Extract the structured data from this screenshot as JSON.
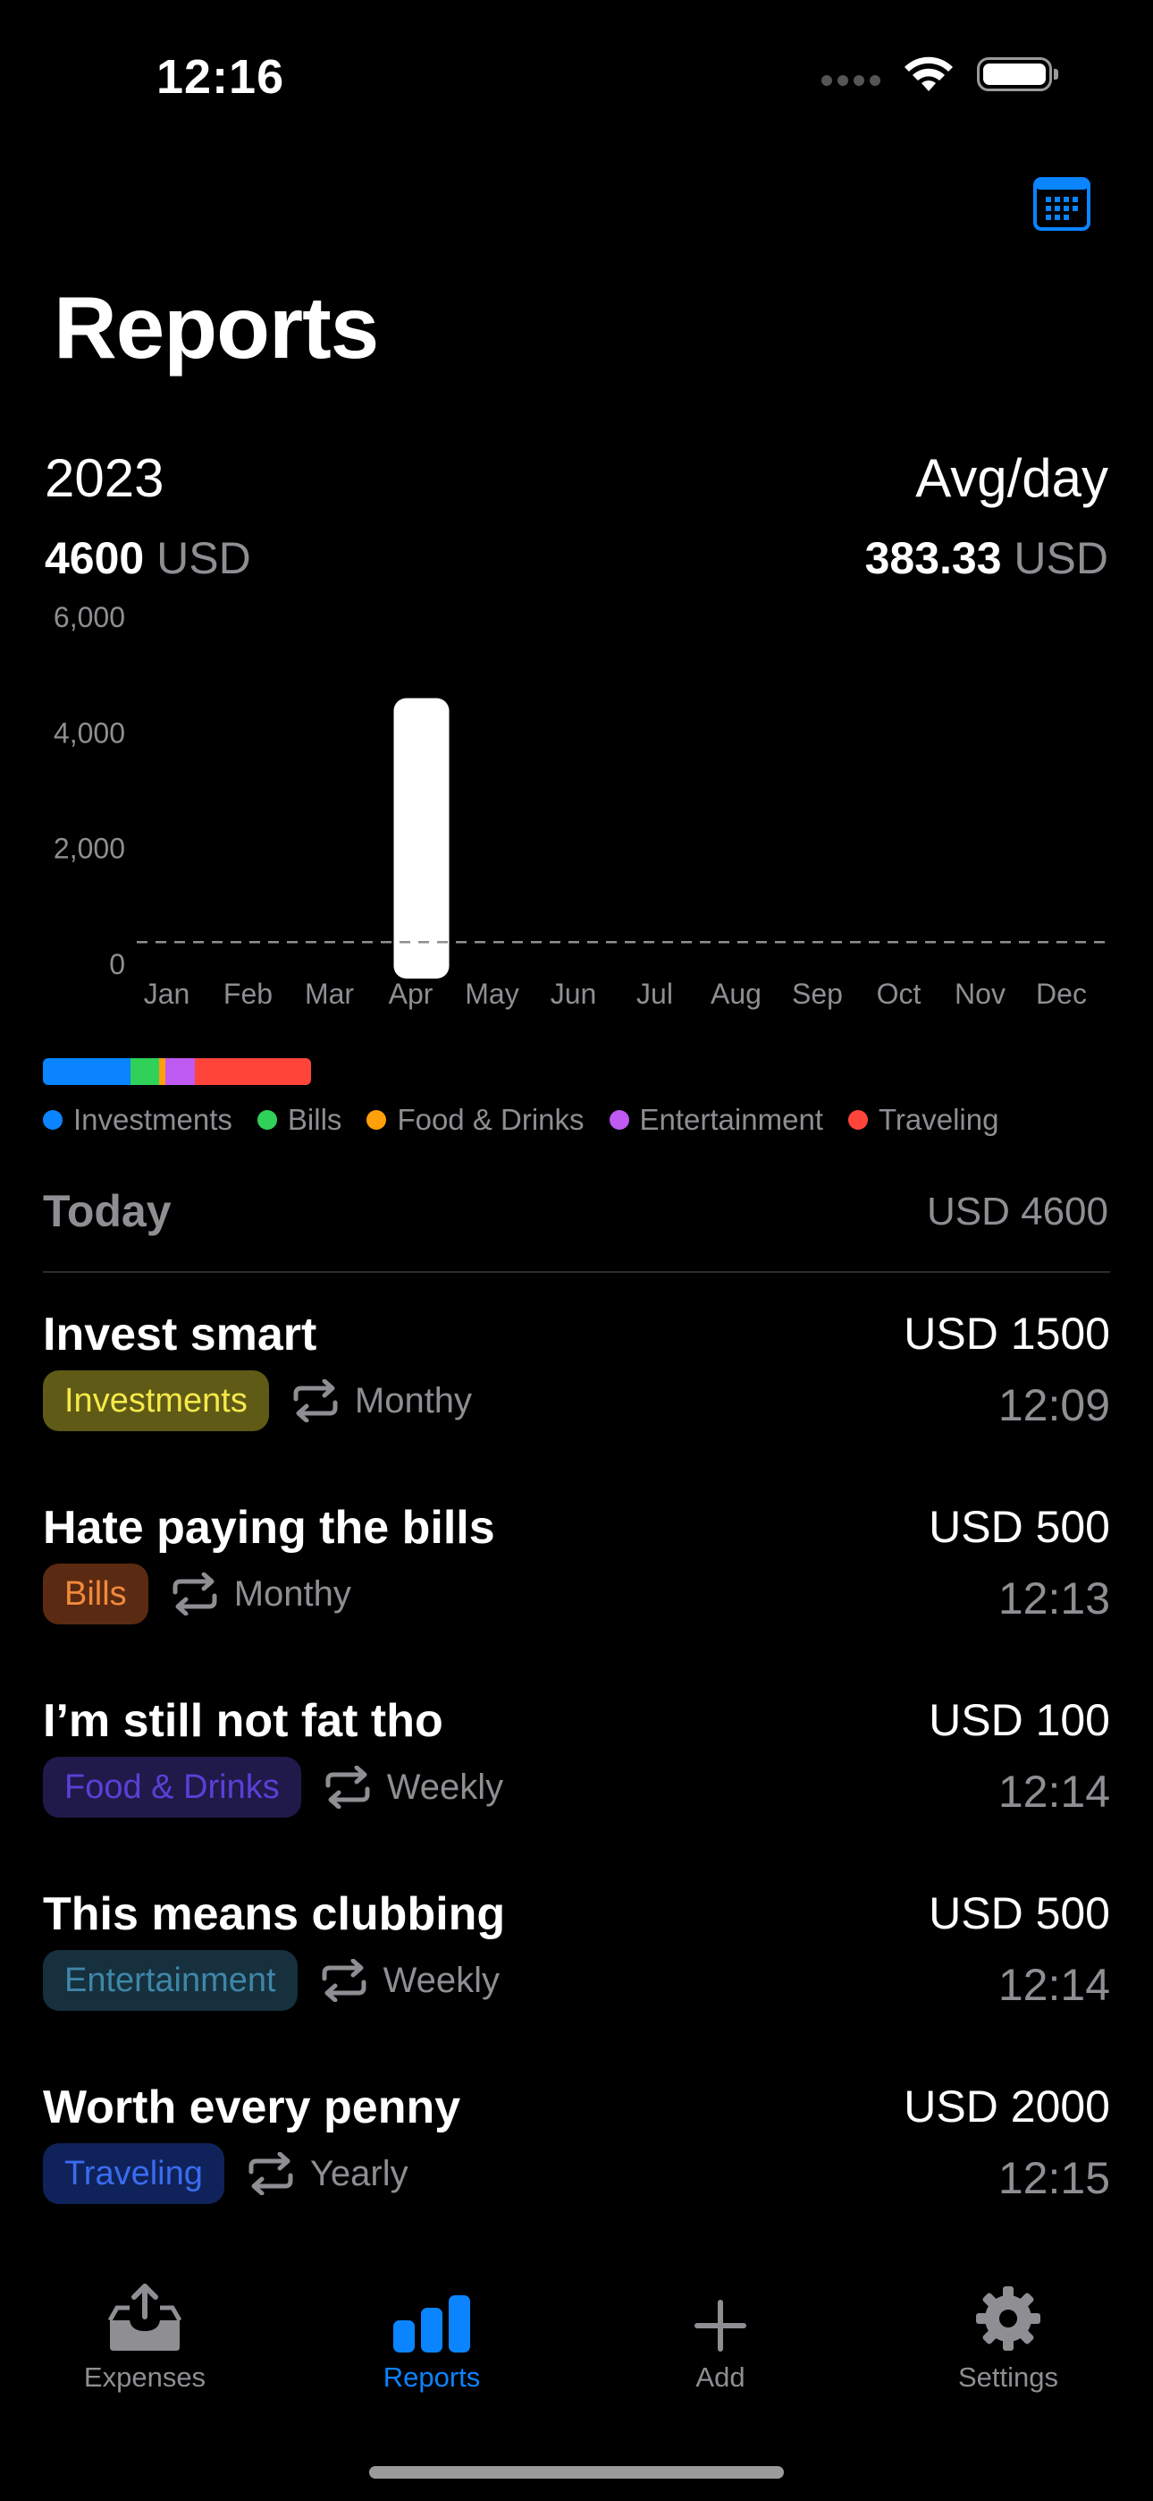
{
  "status_bar": {
    "time": "12:16"
  },
  "header": {
    "title": "Reports"
  },
  "summary": {
    "year": "2023",
    "total_value": "4600",
    "total_unit": "USD",
    "avg_label": "Avg/day",
    "avg_value": "383.33",
    "avg_unit": "USD"
  },
  "chart_data": {
    "type": "bar",
    "categories": [
      "Jan",
      "Feb",
      "Mar",
      "Apr",
      "May",
      "Jun",
      "Jul",
      "Aug",
      "Sep",
      "Oct",
      "Nov",
      "Dec"
    ],
    "values": [
      0,
      0,
      0,
      4600,
      0,
      0,
      0,
      0,
      0,
      0,
      0,
      0
    ],
    "ylim": [
      0,
      6000
    ],
    "yticks": [
      "6,000",
      "4,000",
      "2,000",
      "0"
    ],
    "ytick_values": [
      6000,
      4000,
      2000,
      0
    ],
    "bar_color": "#ffffff",
    "average_line": 383.33
  },
  "category_breakdown": {
    "segments": [
      {
        "name": "Investments",
        "value": 1500,
        "color": "#0a84ff"
      },
      {
        "name": "Bills",
        "value": 500,
        "color": "#30d158"
      },
      {
        "name": "Food & Drinks",
        "value": 100,
        "color": "#ff9f0a"
      },
      {
        "name": "Entertainment",
        "value": 500,
        "color": "#bf5af2"
      },
      {
        "name": "Traveling",
        "value": 2000,
        "color": "#ff453a"
      }
    ]
  },
  "today": {
    "label": "Today",
    "total": "USD 4600",
    "transactions": [
      {
        "title": "Invest smart",
        "amount": "USD 1500",
        "category": "Investments",
        "recurrence": "Monthy",
        "time": "12:09",
        "badge_bg": "#5f5a16",
        "badge_fg": "#f4e94a"
      },
      {
        "title": "Hate paying the bills",
        "amount": "USD 500",
        "category": "Bills",
        "recurrence": "Monthy",
        "time": "12:13",
        "badge_bg": "#5b2a12",
        "badge_fg": "#f08a3c"
      },
      {
        "title": "I’m still not fat tho",
        "amount": "USD 100",
        "category": "Food & Drinks",
        "recurrence": "Weekly",
        "time": "12:14",
        "badge_bg": "#1f1a4a",
        "badge_fg": "#5b3fd6"
      },
      {
        "title": "This means clubbing",
        "amount": "USD 500",
        "category": "Entertainment",
        "recurrence": "Weekly",
        "time": "12:14",
        "badge_bg": "#16303d",
        "badge_fg": "#3f86a8"
      },
      {
        "title": "Worth every penny",
        "amount": "USD 2000",
        "category": "Traveling",
        "recurrence": "Yearly",
        "time": "12:15",
        "badge_bg": "#0f2259",
        "badge_fg": "#3a6cf0"
      }
    ]
  },
  "tabbar": {
    "items": [
      {
        "label": "Expenses",
        "icon": "tray-upload-icon",
        "active": false
      },
      {
        "label": "Reports",
        "icon": "bar-chart-icon",
        "active": true
      },
      {
        "label": "Add",
        "icon": "plus-icon",
        "active": false
      },
      {
        "label": "Settings",
        "icon": "gear-icon",
        "active": false
      }
    ]
  },
  "colors": {
    "accent": "#0a84ff",
    "inactive": "#8e8e93",
    "background": "#000000"
  }
}
